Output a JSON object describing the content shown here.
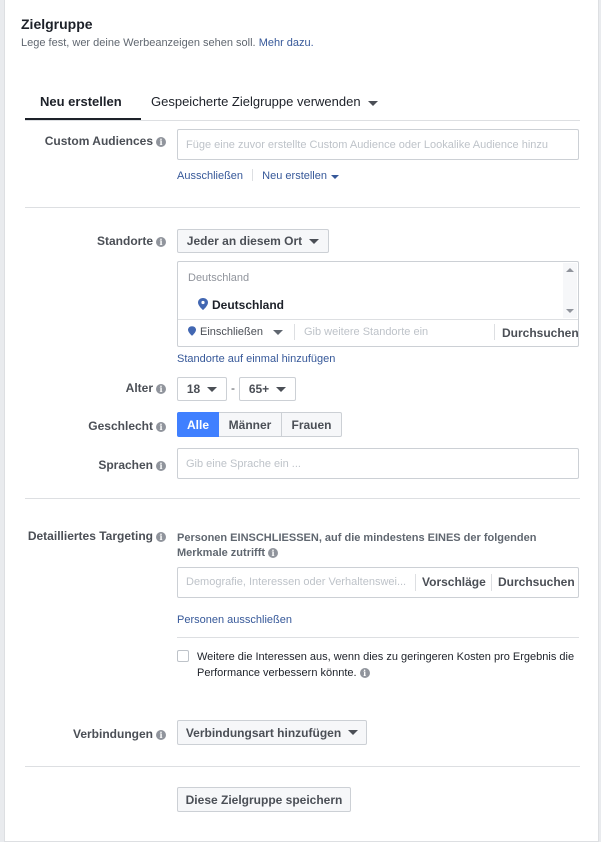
{
  "header": {
    "title": "Zielgruppe",
    "subtitle": "Lege fest, wer deine Werbeanzeigen sehen soll.",
    "more_link": "Mehr dazu."
  },
  "tabs": [
    {
      "label": "Neu erstellen",
      "active": true
    },
    {
      "label": "Gespeicherte Zielgruppe verwenden",
      "active": false
    }
  ],
  "custom_audiences": {
    "label": "Custom Audiences",
    "placeholder": "Füge eine zuvor erstellte Custom Audience oder Lookalike Audience hinzu",
    "exclude_link": "Ausschließen",
    "create_link": "Neu erstellen"
  },
  "locations": {
    "label": "Standorte",
    "dropdown": "Jeder an diesem Ort",
    "group_header": "Deutschland",
    "selected": "Deutschland",
    "include_dropdown": "Einschließen",
    "search_placeholder": "Gib weitere Standorte ein",
    "browse": "Durchsuchen",
    "bulk_link": "Standorte auf einmal hinzufügen"
  },
  "age": {
    "label": "Alter",
    "min": "18",
    "separator": "-",
    "max": "65+"
  },
  "gender": {
    "label": "Geschlecht",
    "options": [
      "Alle",
      "Männer",
      "Frauen"
    ],
    "selected": "Alle"
  },
  "languages": {
    "label": "Sprachen",
    "placeholder": "Gib eine Sprache ein ..."
  },
  "detailed_targeting": {
    "label": "Detailliertes Targeting",
    "description": "Personen EINSCHLIESSEN, auf die mindestens EINES der folgenden Merkmale zutrifft",
    "placeholder": "Demografie, Interessen oder Verhaltenswei...",
    "suggestions": "Vorschläge",
    "browse": "Durchsuchen",
    "exclude_link": "Personen ausschließen",
    "expand_checkbox_text": "Weitere die Interessen aus, wenn dies zu geringeren Kosten pro Ergebnis die Performance verbessern könnte.",
    "expand_checked": false
  },
  "connections": {
    "label": "Verbindungen",
    "dropdown": "Verbindungsart hinzufügen"
  },
  "save_button": "Diese Zielgruppe speichern",
  "colors": {
    "accent": "#4080ff",
    "link": "#365899",
    "text": "#1d2129",
    "muted": "#606770"
  },
  "icons": [
    "info-icon",
    "caret-down-icon",
    "location-pin-icon",
    "scroll-up-icon",
    "scroll-down-icon",
    "checkbox-icon"
  ]
}
